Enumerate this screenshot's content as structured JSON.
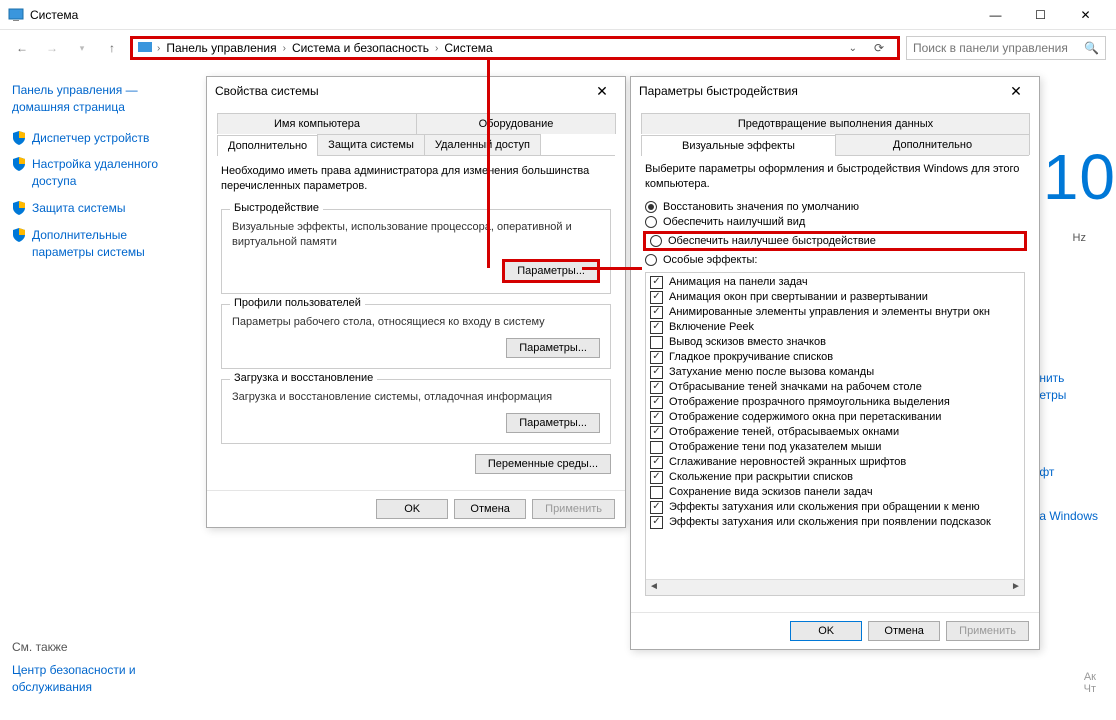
{
  "window": {
    "title": "Система",
    "min": "—",
    "max": "☐",
    "close": "✕"
  },
  "breadcrumb": {
    "segs": [
      "Панель управления",
      "Система и безопасность",
      "Система"
    ]
  },
  "search": {
    "placeholder": "Поиск в панели управления"
  },
  "sidebar": {
    "home": "Панель управления — домашняя страница",
    "items": [
      "Диспетчер устройств",
      "Настройка удаленного доступа",
      "Защита системы",
      "Дополнительные параметры системы"
    ],
    "seealso": "См. также",
    "seealso_item": "Центр безопасности и обслуживания"
  },
  "bg": {
    "win10": "s 10",
    "hz": "Hz",
    "links": [
      "нить\nетры",
      "фт",
      "а Windows"
    ],
    "activate": "Ак\nЧт"
  },
  "dlg1": {
    "title": "Свойства системы",
    "tabs_top": [
      "Имя компьютера",
      "Оборудование"
    ],
    "tabs_bot": [
      "Дополнительно",
      "Защита системы",
      "Удаленный доступ"
    ],
    "note": "Необходимо иметь права администратора для изменения большинства перечисленных параметров.",
    "g1": {
      "t": "Быстродействие",
      "d": "Визуальные эффекты, использование процессора, оперативной и виртуальной памяти",
      "btn": "Параметры..."
    },
    "g2": {
      "t": "Профили пользователей",
      "d": "Параметры рабочего стола, относящиеся ко входу в систему",
      "btn": "Параметры..."
    },
    "g3": {
      "t": "Загрузка и восстановление",
      "d": "Загрузка и восстановление системы, отладочная информация",
      "btn": "Параметры..."
    },
    "env": "Переменные среды...",
    "ok": "OK",
    "cancel": "Отмена",
    "apply": "Применить"
  },
  "dlg2": {
    "title": "Параметры быстродействия",
    "tabs_top": [
      "Предотвращение выполнения данных"
    ],
    "tabs_bot": [
      "Визуальные эффекты",
      "Дополнительно"
    ],
    "instr": "Выберите параметры оформления и быстродействия Windows для этого компьютера.",
    "radios": [
      {
        "label": "Восстановить значения по умолчанию",
        "sel": true,
        "hl": false
      },
      {
        "label": "Обеспечить наилучший вид",
        "sel": false,
        "hl": false
      },
      {
        "label": "Обеспечить наилучшее быстродействие",
        "sel": false,
        "hl": true
      },
      {
        "label": "Особые эффекты:",
        "sel": false,
        "hl": false
      }
    ],
    "checks": [
      {
        "c": true,
        "t": "Анимация на панели задач"
      },
      {
        "c": true,
        "t": "Анимация окон при свертывании и развертывании"
      },
      {
        "c": true,
        "t": "Анимированные элементы управления и элементы внутри окн"
      },
      {
        "c": true,
        "t": "Включение Peek"
      },
      {
        "c": false,
        "t": "Вывод эскизов вместо значков"
      },
      {
        "c": true,
        "t": "Гладкое прокручивание списков"
      },
      {
        "c": true,
        "t": "Затухание меню после вызова команды"
      },
      {
        "c": true,
        "t": "Отбрасывание теней значками на рабочем столе"
      },
      {
        "c": true,
        "t": "Отображение прозрачного прямоугольника выделения"
      },
      {
        "c": true,
        "t": "Отображение содержимого окна при перетаскивании"
      },
      {
        "c": true,
        "t": "Отображение теней, отбрасываемых окнами"
      },
      {
        "c": false,
        "t": "Отображение тени под указателем мыши"
      },
      {
        "c": true,
        "t": "Сглаживание неровностей экранных шрифтов"
      },
      {
        "c": true,
        "t": "Скольжение при раскрытии списков"
      },
      {
        "c": false,
        "t": "Сохранение вида эскизов панели задач"
      },
      {
        "c": true,
        "t": "Эффекты затухания или скольжения при обращении к меню"
      },
      {
        "c": true,
        "t": "Эффекты затухания или скольжения при появлении подсказок"
      }
    ],
    "ok": "OK",
    "cancel": "Отмена",
    "apply": "Применить"
  }
}
